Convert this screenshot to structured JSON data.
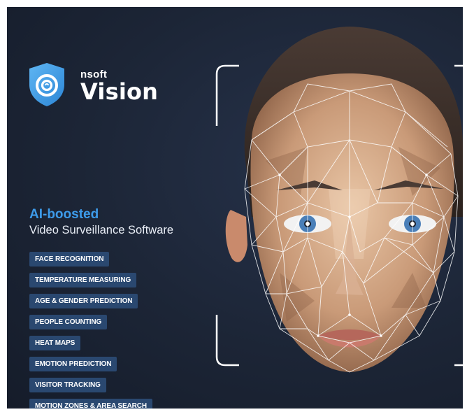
{
  "brand": {
    "small": "nsoft",
    "name": "Vision",
    "colors": {
      "shield": "#3e9fe7",
      "accent": "#3d9bea"
    }
  },
  "headline": "AI-boosted",
  "subheadline": "Video Surveillance Software",
  "features": [
    "FACE RECOGNITION",
    "TEMPERATURE MEASURING",
    "AGE & GENDER PREDICTION",
    "PEOPLE COUNTING",
    "HEAT MAPS",
    "EMOTION PREDICTION",
    "VISITOR TRACKING",
    "MOTION ZONES & AREA SEARCH"
  ],
  "illustration": "polygon-face-mesh-with-scan-brackets"
}
